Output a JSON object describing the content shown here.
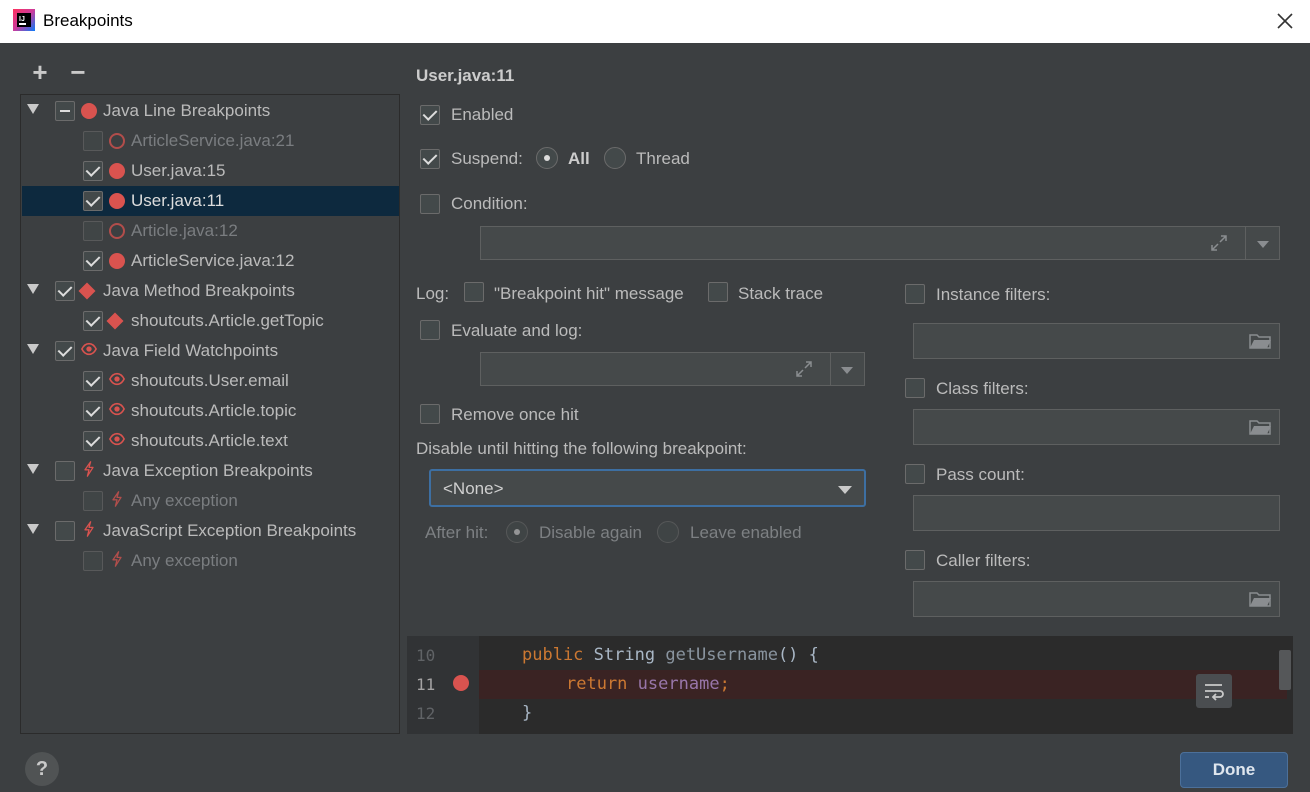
{
  "window": {
    "title": "Breakpoints"
  },
  "tree": {
    "items": [
      {
        "label": "Java Line Breakpoints",
        "level": 0,
        "checked": "partial",
        "icon": "red-dot-icon",
        "dim": false
      },
      {
        "label": "ArticleService.java:21",
        "level": 1,
        "checked": "off",
        "icon": "red-ring-icon",
        "dim": true
      },
      {
        "label": "User.java:15",
        "level": 1,
        "checked": "on",
        "icon": "red-dot-icon",
        "dim": false
      },
      {
        "label": "User.java:11",
        "level": 1,
        "checked": "on",
        "icon": "red-dot-icon",
        "dim": false,
        "selected": true
      },
      {
        "label": "Article.java:12",
        "level": 1,
        "checked": "off",
        "icon": "red-ring-icon",
        "dim": true
      },
      {
        "label": "ArticleService.java:12",
        "level": 1,
        "checked": "on",
        "icon": "red-dot-icon",
        "dim": false
      },
      {
        "label": "Java Method Breakpoints",
        "level": 0,
        "checked": "on",
        "icon": "red-diamond-icon",
        "dim": false
      },
      {
        "label": "shoutcuts.Article.getTopic",
        "level": 1,
        "checked": "on",
        "icon": "red-diamond-icon",
        "dim": false
      },
      {
        "label": "Java Field Watchpoints",
        "level": 0,
        "checked": "on",
        "icon": "eye-icon",
        "dim": false
      },
      {
        "label": "shoutcuts.User.email",
        "level": 1,
        "checked": "on",
        "icon": "eye-icon",
        "dim": false
      },
      {
        "label": "shoutcuts.Article.topic",
        "level": 1,
        "checked": "on",
        "icon": "eye-icon",
        "dim": false
      },
      {
        "label": "shoutcuts.Article.text",
        "level": 1,
        "checked": "on",
        "icon": "eye-icon",
        "dim": false
      },
      {
        "label": "Java Exception Breakpoints",
        "level": 0,
        "checked": "off",
        "icon": "lightning-icon",
        "dim": false
      },
      {
        "label": "Any exception",
        "level": 1,
        "checked": "off",
        "icon": "lightning-icon",
        "dim": true
      },
      {
        "label": "JavaScript Exception Breakpoints",
        "level": 0,
        "checked": "off",
        "icon": "lightning-icon",
        "dim": false
      },
      {
        "label": "Any exception",
        "level": 1,
        "checked": "off",
        "icon": "lightning-icon",
        "dim": true
      }
    ]
  },
  "toolbar": {
    "add": "+",
    "remove": "−"
  },
  "details": {
    "title": "User.java:11",
    "enabled_label": "Enabled",
    "suspend_label": "Suspend:",
    "suspend_all": "All",
    "suspend_thread": "Thread",
    "condition_label": "Condition:",
    "log_label": "Log:",
    "log_message": "\"Breakpoint hit\" message",
    "log_stack": "Stack trace",
    "evaluate_label": "Evaluate and log:",
    "remove_once": "Remove once hit",
    "disable_until": "Disable until hitting the following breakpoint:",
    "disable_until_value": "<None>",
    "after_hit": "After hit:",
    "disable_again": "Disable again",
    "leave_enabled": "Leave enabled",
    "instance_filters": "Instance filters:",
    "class_filters": "Class filters:",
    "pass_count": "Pass count:",
    "caller_filters": "Caller filters:"
  },
  "code_preview": {
    "line_numbers": [
      "10",
      "11",
      "12"
    ],
    "line10": {
      "kw": "public",
      "type": "String",
      "fn": "getUsername",
      "rest": "() {"
    },
    "line11": {
      "kw": "return",
      "field": "username",
      "rest": ";"
    },
    "line12": "}"
  },
  "footer": {
    "help": "?",
    "done": "Done"
  },
  "colors": {
    "accent": "#365880",
    "breakpoint": "#d9534f",
    "selection": "#0d293e"
  }
}
